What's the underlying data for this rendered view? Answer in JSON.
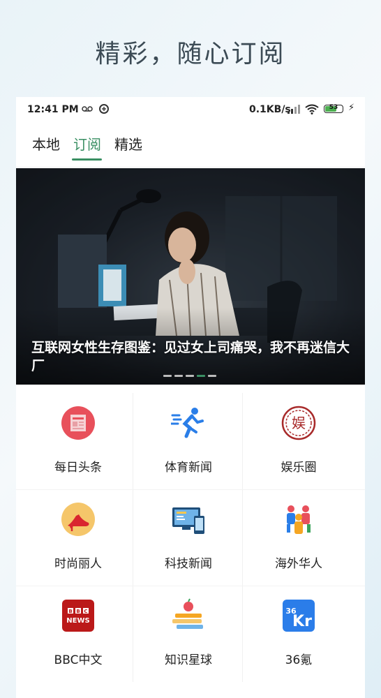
{
  "headline": "精彩，随心订阅",
  "status_bar": {
    "time": "12:41 PM",
    "speed": "0.1KB/s",
    "battery": "53"
  },
  "tabs": [
    {
      "label": "本地",
      "active": false
    },
    {
      "label": "订阅",
      "active": true
    },
    {
      "label": "精选",
      "active": false
    }
  ],
  "banner": {
    "caption": "互联网女性生存图鉴：见过女上司痛哭，我不再迷信大厂",
    "dots_total": 5,
    "dots_active": 4
  },
  "channels": [
    {
      "label": "每日头条",
      "icon": "newspaper-icon"
    },
    {
      "label": "体育新闻",
      "icon": "runner-icon"
    },
    {
      "label": "娱乐圈",
      "icon": "entertainment-seal-icon"
    },
    {
      "label": "时尚丽人",
      "icon": "high-heel-icon"
    },
    {
      "label": "科技新闻",
      "icon": "devices-icon"
    },
    {
      "label": "海外华人",
      "icon": "people-icon"
    },
    {
      "label": "BBC中文",
      "icon": "bbc-news-icon",
      "logo_text": "BBC NEWS"
    },
    {
      "label": "知识星球",
      "icon": "books-apple-icon"
    },
    {
      "label": "36氪",
      "icon": "36kr-icon",
      "logo_text": "36Kr"
    }
  ],
  "colors": {
    "accent": "#3a8f63",
    "text": "#222222"
  }
}
